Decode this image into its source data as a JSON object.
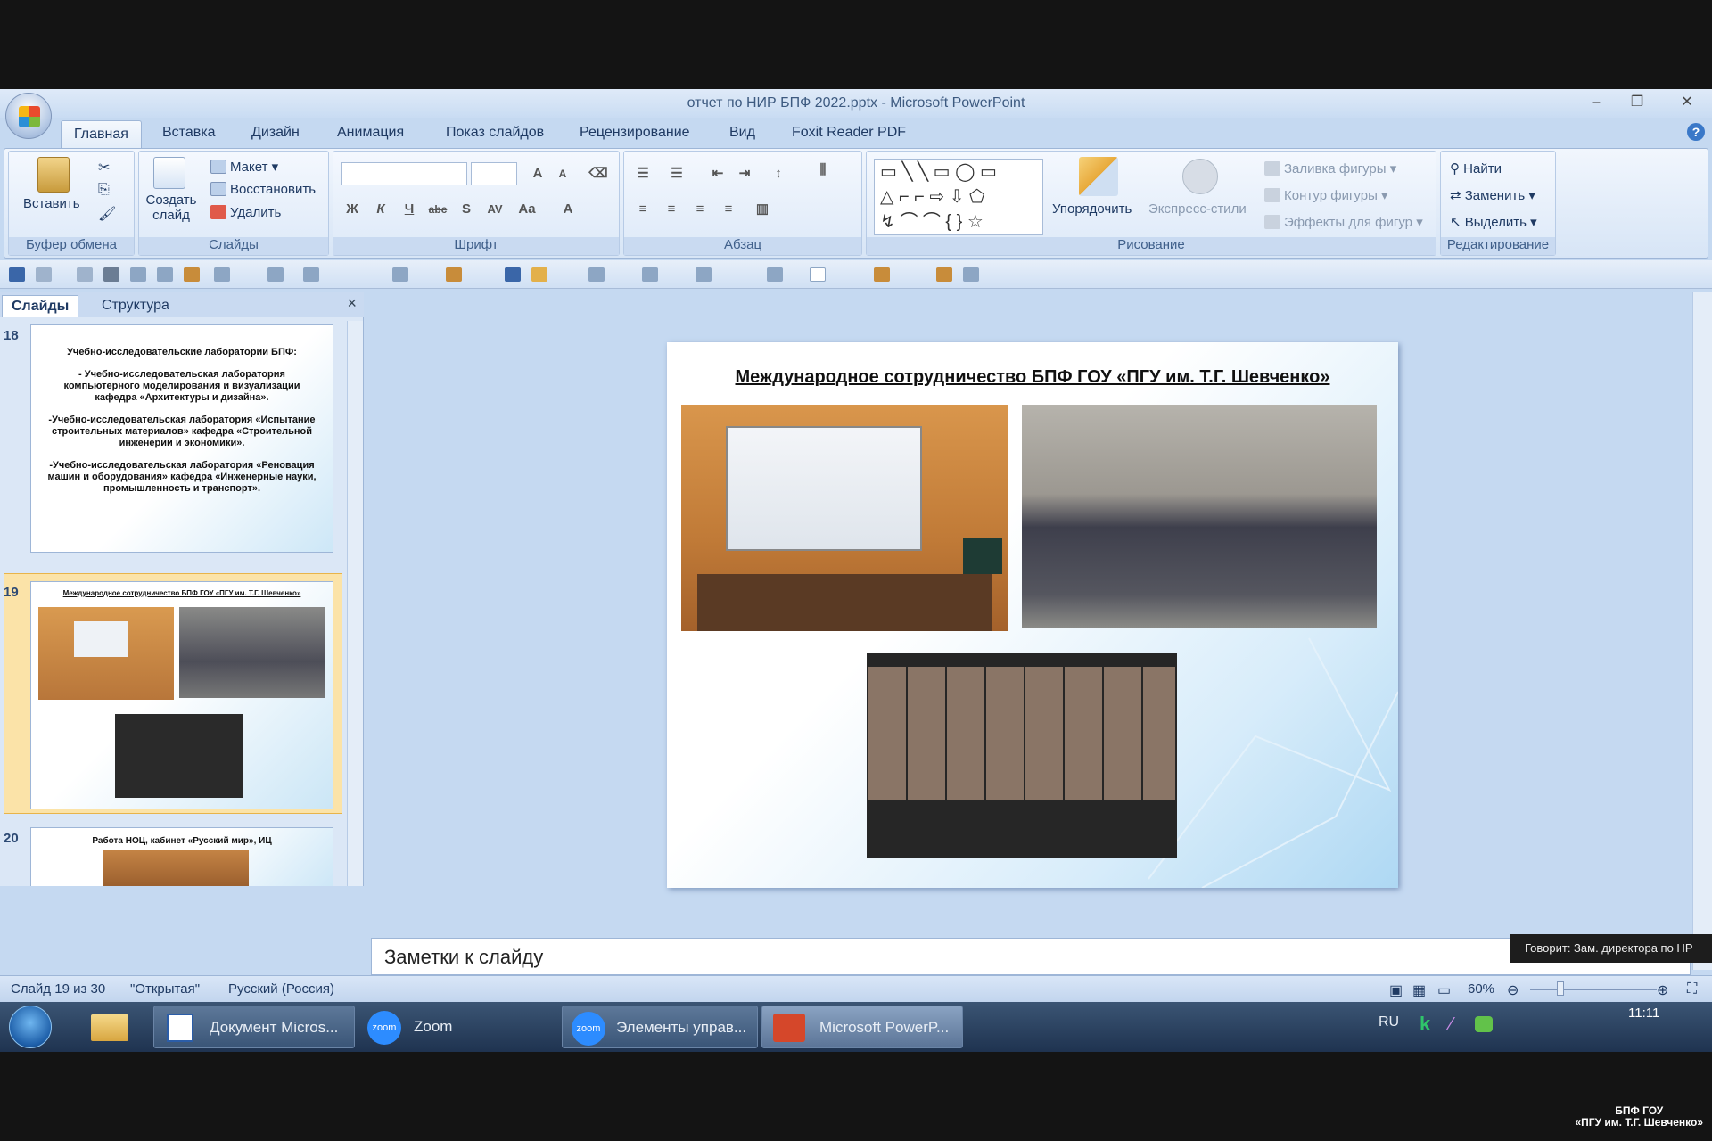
{
  "window": {
    "title": "отчет по НИР БПФ 2022.pptx - Microsoft PowerPoint"
  },
  "tabs": [
    "Главная",
    "Вставка",
    "Дизайн",
    "Анимация",
    "Показ слайдов",
    "Рецензирование",
    "Вид",
    "Foxit Reader PDF"
  ],
  "ribbon": {
    "clipboard": {
      "paste": "Вставить",
      "label": "Буфер обмена"
    },
    "slides": {
      "create": "Создать слайд",
      "layout": "Макет",
      "reset": "Восстановить",
      "delete": "Удалить",
      "label": "Слайды"
    },
    "font": {
      "label": "Шрифт",
      "bold": "Ж",
      "italic": "К",
      "underline": "Ч",
      "strike": "abc",
      "shadow": "S",
      "spacing": "AV",
      "case": "Aa",
      "color": "A"
    },
    "paragraph": {
      "label": "Абзац"
    },
    "drawing": {
      "arrange": "Упорядочить",
      "styles": "Экспресс-стили",
      "fill": "Заливка фигуры",
      "outline": "Контур фигуры",
      "effects": "Эффекты для фигур",
      "label": "Рисование"
    },
    "editing": {
      "find": "Найти",
      "replace": "Заменить",
      "select": "Выделить",
      "label": "Редактирование"
    }
  },
  "pane": {
    "tab_slides": "Слайды",
    "tab_outline": "Структура"
  },
  "thumbs": [
    {
      "num": "18",
      "lines": [
        "Учебно-исследовательские лаборатории БПФ:",
        "- Учебно-исследовательская лаборатория компьютерного моделирования и визуализации кафедра «Архитектуры и дизайна».",
        "-Учебно-исследовательская лаборатория «Испытание строительных материалов» кафедра «Строительной инженерии и экономики».",
        "-Учебно-исследовательская лаборатория «Реновация машин и оборудования» кафедра «Инженерные науки, промышленность и транспорт»."
      ]
    },
    {
      "num": "19",
      "title": "Международное сотрудничество БПФ ГОУ «ПГУ им. Т.Г. Шевченко»"
    },
    {
      "num": "20",
      "title": "Работа НОЦ, кабинет «Русский мир», ИЦ"
    }
  ],
  "slide": {
    "title": "Международное сотрудничество БПФ ГОУ «ПГУ им. Т.Г. Шевченко»"
  },
  "notes": {
    "placeholder": "Заметки к слайду"
  },
  "status": {
    "slide": "Слайд 19 из 30",
    "theme": "\"Открытая\"",
    "lang": "Русский (Россия)",
    "zoom": "60%"
  },
  "taskbar": {
    "items": [
      "Документ Micros...",
      "Zoom",
      "Элементы управ...",
      "Microsoft PowerP..."
    ],
    "lang": "RU",
    "time": "11:11",
    "zoom_logo": "zoom"
  },
  "overlay": {
    "speaker": "Говорит: Зам. директора по НР",
    "watermark1": "БПФ ГОУ",
    "watermark2": "«ПГУ им. Т.Г. Шевченко»"
  },
  "colors": {
    "ribbon": "#dfeaf8",
    "accent": "#f8c55a",
    "zoom": "#2d8cff"
  }
}
